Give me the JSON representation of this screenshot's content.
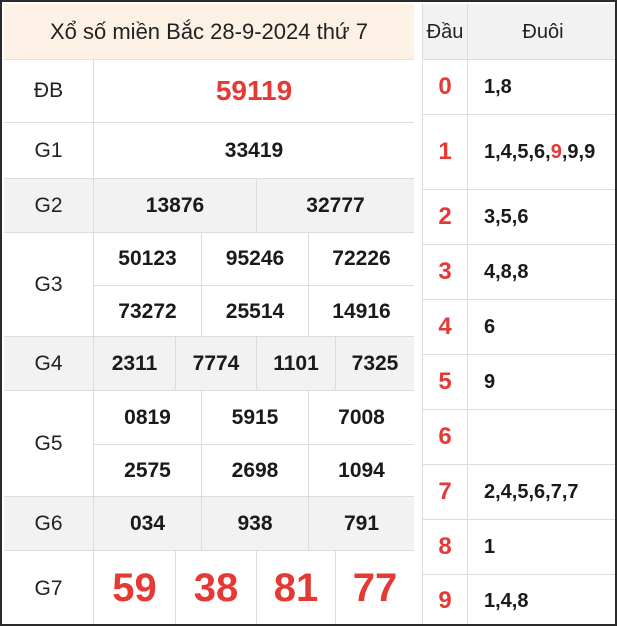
{
  "title": "Xổ số miền Bắc 28-9-2024 thứ 7",
  "prizes": {
    "db": {
      "label": "ĐB",
      "numbers": [
        "59119"
      ]
    },
    "g1": {
      "label": "G1",
      "numbers": [
        "33419"
      ]
    },
    "g2": {
      "label": "G2",
      "numbers": [
        "13876",
        "32777"
      ]
    },
    "g3": {
      "label": "G3",
      "numbers": [
        "50123",
        "95246",
        "72226",
        "73272",
        "25514",
        "14916"
      ]
    },
    "g4": {
      "label": "G4",
      "numbers": [
        "2311",
        "7774",
        "1101",
        "7325"
      ]
    },
    "g5": {
      "label": "G5",
      "numbers": [
        "0819",
        "5915",
        "7008",
        "2575",
        "2698",
        "1094"
      ]
    },
    "g6": {
      "label": "G6",
      "numbers": [
        "034",
        "938",
        "791"
      ]
    },
    "g7": {
      "label": "G7",
      "numbers": [
        "59",
        "38",
        "81",
        "77"
      ]
    }
  },
  "loto": {
    "header_dau": "Đầu",
    "header_duoi": "Đuôi",
    "rows": [
      {
        "dau": "0",
        "duoi": "1,8"
      },
      {
        "dau": "1",
        "duoi_before": "1,4,5,6,",
        "duoi_highlight": "9",
        "duoi_after": ",9,9"
      },
      {
        "dau": "2",
        "duoi": "3,5,6"
      },
      {
        "dau": "3",
        "duoi": "4,8,8"
      },
      {
        "dau": "4",
        "duoi": "6"
      },
      {
        "dau": "5",
        "duoi": "9"
      },
      {
        "dau": "6",
        "duoi": ""
      },
      {
        "dau": "7",
        "duoi": "2,4,5,6,7,7"
      },
      {
        "dau": "8",
        "duoi": "1"
      },
      {
        "dau": "9",
        "duoi": "1,4,8"
      }
    ]
  },
  "colors": {
    "accent_red": "#e53935",
    "header_bg": "#fdf0e4",
    "row_gray": "#f2f2f2"
  }
}
